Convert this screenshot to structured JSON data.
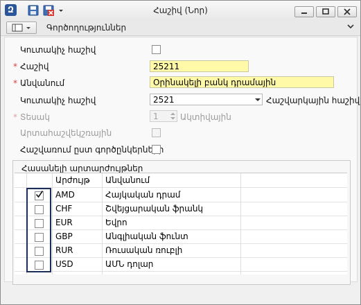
{
  "window": {
    "title": "Հաշիվ (Նոր)"
  },
  "ribbon": {
    "group_label": "Գործողություններ"
  },
  "form": {
    "control_account_top_label": "Կուտակիչ հաշիվ",
    "control_account_top_checked": false,
    "account_label": "Հաշիվ",
    "account_value": "25211",
    "name_label": "Անվանում",
    "name_value": "Օրինակելի բանկ դրամային",
    "control_account_label": "Կուտակիչ հաշիվ",
    "control_account_value": "2521",
    "balance_account_label": "Հաշվարկային հաշիվ",
    "type_label": "Տեսակ",
    "type_value": "1",
    "type_text": "Ակտիվային",
    "offbalance_label": "Արտահաշվեկշռային",
    "offbalance_checked": false,
    "calc_by_partners_label": "Հաշվառում ըստ գործընկերների",
    "calc_by_partners_checked": false
  },
  "currencies": {
    "group_title": "Հասանելի արտարժույթներ",
    "columns": [
      "Արժույթ",
      "Անվանում"
    ],
    "rows": [
      {
        "code": "AMD",
        "name": "Հայկական դրամ",
        "checked": true
      },
      {
        "code": "CHF",
        "name": "Շվեյցարական ֆրանկ",
        "checked": false
      },
      {
        "code": "EUR",
        "name": "Եվրո",
        "checked": false
      },
      {
        "code": "GBP",
        "name": "Անգլիական ֆունտ",
        "checked": false
      },
      {
        "code": "RUR",
        "name": "Ռուսական ռուբլի",
        "checked": false
      },
      {
        "code": "USD",
        "name": "ԱՄՆ դոլար",
        "checked": false
      }
    ]
  },
  "colors": {
    "required_marker": "#d83b3b",
    "highlight_field": "#fff9a8",
    "selection_frame": "#1b2d5a"
  }
}
